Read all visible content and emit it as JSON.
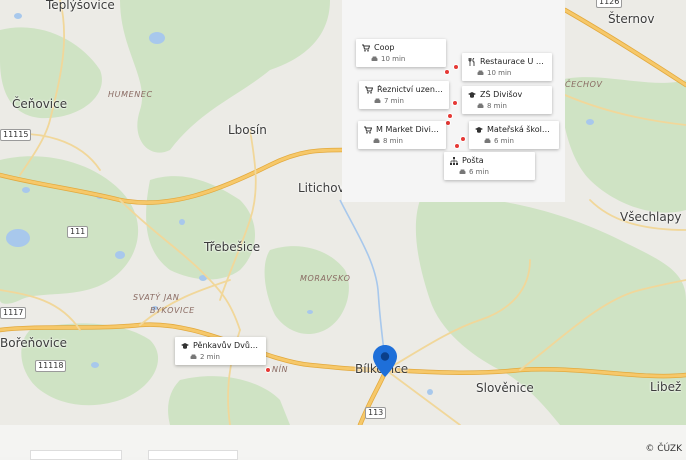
{
  "places": [
    {
      "id": "teplysovice",
      "name": "Teplýšovice"
    },
    {
      "id": "cenovice",
      "name": "Čeňovice"
    },
    {
      "id": "lbosin",
      "name": "Lbosín"
    },
    {
      "id": "litichovice",
      "name": "Litichovi"
    },
    {
      "id": "trebesice",
      "name": "Třebešice"
    },
    {
      "id": "borenovice",
      "name": "Bořeňovice"
    },
    {
      "id": "bilkovice",
      "name": "Bílkovice"
    },
    {
      "id": "slovenice",
      "name": "Slověnice"
    },
    {
      "id": "sternov",
      "name": "Šternov"
    },
    {
      "id": "vechlapy",
      "name": "Všechlapy"
    },
    {
      "id": "libez",
      "name": "Libež"
    }
  ],
  "regions": [
    {
      "id": "humenec",
      "name": "HUMENEC"
    },
    {
      "id": "moravsko",
      "name": "MORAVSKO"
    },
    {
      "id": "svatyjan",
      "name": "SVATÝ JAN"
    },
    {
      "id": "bykovice",
      "name": "BYKOVICE"
    },
    {
      "id": "cechov",
      "name": "ČECHOV"
    },
    {
      "id": "tanin",
      "name": "NÍN"
    }
  ],
  "roads": [
    {
      "id": "r11115",
      "number": "11115"
    },
    {
      "id": "r111",
      "number": "111"
    },
    {
      "id": "r1117",
      "number": "1117"
    },
    {
      "id": "r11118",
      "number": "11118"
    },
    {
      "id": "r113",
      "number": "113"
    },
    {
      "id": "r1126",
      "number": "1126"
    }
  ],
  "pois": [
    {
      "id": "coop",
      "name": "Coop",
      "icon": "cart-icon",
      "time": "10 min",
      "mode": "car-icon"
    },
    {
      "id": "restaurace",
      "name": "Restaurace U Sok...",
      "icon": "cutlery-icon",
      "time": "10 min",
      "mode": "car-icon"
    },
    {
      "id": "reznictvi",
      "name": "Řeznictví uzenářs...",
      "icon": "cart-icon",
      "time": "7 min",
      "mode": "car-icon"
    },
    {
      "id": "zs",
      "name": "ZŠ Divišov",
      "icon": "school-icon",
      "time": "8 min",
      "mode": "car-icon"
    },
    {
      "id": "mmarket",
      "name": "M Market Divišov",
      "icon": "cart-icon",
      "time": "8 min",
      "mode": "car-icon"
    },
    {
      "id": "ms",
      "name": "Mateřská škola D...",
      "icon": "school-icon",
      "time": "6 min",
      "mode": "car-icon"
    },
    {
      "id": "posta",
      "name": "Pošta",
      "icon": "org-icon",
      "time": "6 min",
      "mode": "car-icon"
    },
    {
      "id": "penkavuv",
      "name": "Pěnkavův Dvůr Ta...",
      "icon": "school-icon",
      "time": "2 min",
      "mode": "car-icon"
    }
  ],
  "footer": {
    "copyright": "© ČÚZK"
  },
  "colors": {
    "water": "#a8c8ec",
    "forest": "#cfe3c4",
    "road": "#f6c86a",
    "road_edge": "#e3a93c",
    "pin": "#1e6fd9",
    "poi_dot": "#e53935"
  }
}
